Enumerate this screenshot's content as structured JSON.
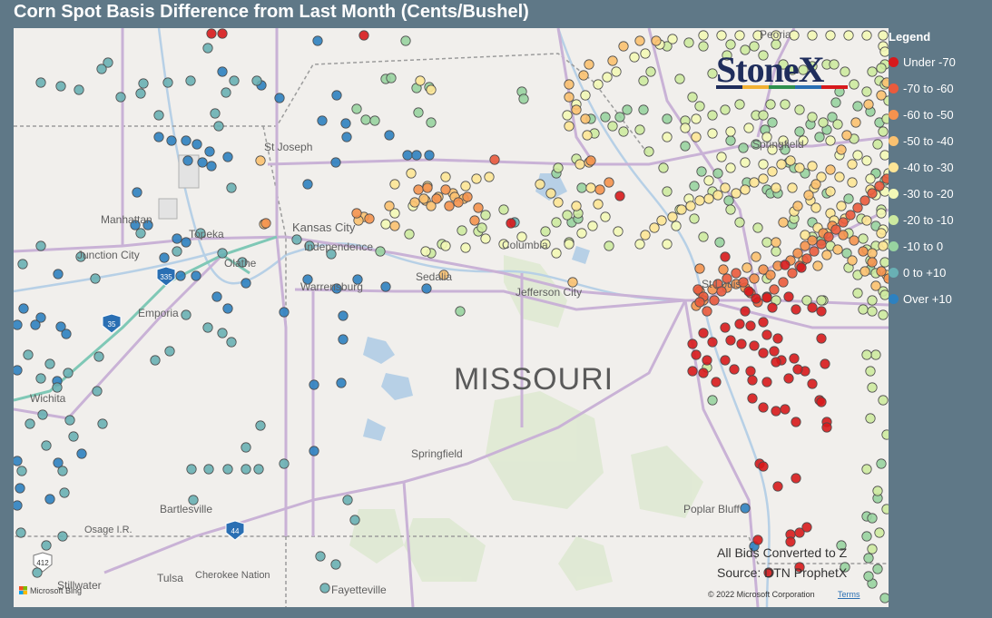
{
  "title": "Corn Spot Basis Difference from Last Month (Cents/Bushel)",
  "legend": {
    "title": "Legend",
    "items": [
      {
        "label": "Under -70",
        "color": "#d7191c"
      },
      {
        "label": "-70 to -60",
        "color": "#ea5a3c"
      },
      {
        "label": "-60 to -50",
        "color": "#f4924e"
      },
      {
        "label": "-50 to -40",
        "color": "#fbc170"
      },
      {
        "label": "-40 to -30",
        "color": "#fde596"
      },
      {
        "label": "-30 to -20",
        "color": "#f3f8b6"
      },
      {
        "label": "-20 to -10",
        "color": "#cdeaa0"
      },
      {
        "label": "-10 to 0",
        "color": "#98d3a0"
      },
      {
        "label": "0 to +10",
        "color": "#69b0b4"
      },
      {
        "label": "Over +10",
        "color": "#2d81c0"
      }
    ]
  },
  "logo": {
    "text": "StoneX",
    "colors": [
      "#1f2d5c",
      "#f2b134",
      "#2f8f4e",
      "#2a6fb3",
      "#d7191c"
    ]
  },
  "map": {
    "state_label": "MISSOURI",
    "places": [
      {
        "name": "Peoria"
      },
      {
        "name": "St Joseph"
      },
      {
        "name": "Springfield"
      },
      {
        "name": "Manhattan"
      },
      {
        "name": "Topeka"
      },
      {
        "name": "Kansas City"
      },
      {
        "name": "Independence"
      },
      {
        "name": "Columbia"
      },
      {
        "name": "Junction City"
      },
      {
        "name": "Olathe"
      },
      {
        "name": "Warrensburg"
      },
      {
        "name": "Sedalia"
      },
      {
        "name": "Jefferson City"
      },
      {
        "name": "St Louis"
      },
      {
        "name": "Emporia"
      },
      {
        "name": "Wichita"
      },
      {
        "name": "Springfield"
      },
      {
        "name": "Bartlesville"
      },
      {
        "name": "Poplar Bluff"
      },
      {
        "name": "Osage I.R."
      },
      {
        "name": "Stillwater"
      },
      {
        "name": "Tulsa"
      },
      {
        "name": "Cherokee Nation"
      },
      {
        "name": "Fayetteville"
      }
    ],
    "highways": [
      "35",
      "335",
      "44",
      "412"
    ],
    "source_line1": "All Bids Converted to Z",
    "source_line2": "Source: DTN ProphetX",
    "copyright": "© 2022 Microsoft Corporation",
    "terms": "Terms",
    "attribution": "Microsoft Bing"
  }
}
